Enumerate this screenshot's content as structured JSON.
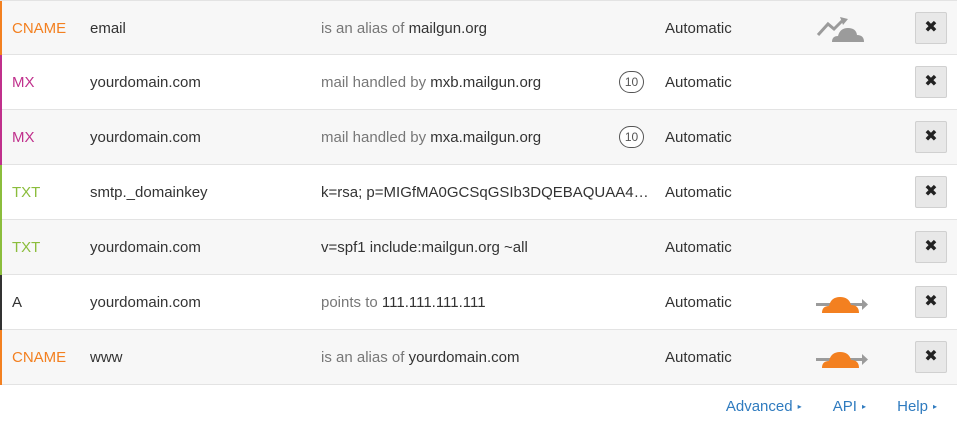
{
  "records": [
    {
      "type": "CNAME",
      "type_color": "#f38020",
      "name": "email",
      "value_prefix": "is an alias of",
      "value": "mailgun.org",
      "priority": "",
      "ttl": "Automatic",
      "proxy": "dns-only",
      "delete_icon": "✖"
    },
    {
      "type": "MX",
      "type_color": "#c0308c",
      "name": "yourdomain.com",
      "value_prefix": "mail handled by",
      "value": "mxb.mailgun.org",
      "priority": "10",
      "ttl": "Automatic",
      "proxy": "none",
      "delete_icon": "✖"
    },
    {
      "type": "MX",
      "type_color": "#c0308c",
      "name": "yourdomain.com",
      "value_prefix": "mail handled by",
      "value": "mxa.mailgun.org",
      "priority": "10",
      "ttl": "Automatic",
      "proxy": "none",
      "delete_icon": "✖"
    },
    {
      "type": "TXT",
      "type_color": "#8bbd3c",
      "name": "smtp._domainkey",
      "value_prefix": "",
      "value": "k=rsa; p=MIGfMA0GCSqGSIb3DQEBAQUAA4G…",
      "priority": "",
      "ttl": "Automatic",
      "proxy": "none",
      "delete_icon": "✖"
    },
    {
      "type": "TXT",
      "type_color": "#8bbd3c",
      "name": "yourdomain.com",
      "value_prefix": "",
      "value": "v=spf1 include:mailgun.org ~all",
      "priority": "",
      "ttl": "Automatic",
      "proxy": "none",
      "delete_icon": "✖"
    },
    {
      "type": "A",
      "type_color": "#333333",
      "name": "yourdomain.com",
      "value_prefix": "points to",
      "value": "111.111.111.111",
      "priority": "",
      "ttl": "Automatic",
      "proxy": "proxied",
      "delete_icon": "✖"
    },
    {
      "type": "CNAME",
      "type_color": "#f38020",
      "name": "www",
      "value_prefix": "is an alias of",
      "value": "yourdomain.com",
      "priority": "",
      "ttl": "Automatic",
      "proxy": "proxied",
      "delete_icon": "✖"
    }
  ],
  "colors": {
    "link": "#2f7bbf",
    "cloud_active": "#f38020",
    "cloud_inactive": "#9b9b9b",
    "row_alt": "#f7f7f7"
  },
  "footer": {
    "advanced_label": "Advanced",
    "api_label": "API",
    "help_label": "Help",
    "arrow_icon": "▸"
  }
}
